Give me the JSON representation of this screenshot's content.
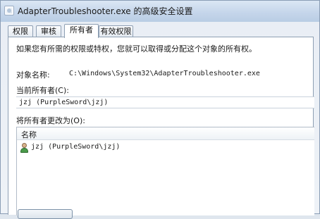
{
  "window": {
    "title": "AdapterTroubleshooter.exe 的高级安全设置"
  },
  "tabs": [
    {
      "label": "权限",
      "active": false
    },
    {
      "label": "审核",
      "active": false
    },
    {
      "label": "所有者",
      "active": true
    },
    {
      "label": "有效权限",
      "active": false
    }
  ],
  "owner_tab": {
    "intro": "如果您有所需的权限或特权，您就可以取得或分配这个对象的所有权。",
    "object_name_label": "对象名称:",
    "object_name_value": "C:\\Windows\\System32\\AdapterTroubleshooter.exe",
    "current_owner_label": "当前所有者(C):",
    "current_owner_value": "jzj (PurpleSword\\jzj)",
    "change_owner_label": "将所有者更改为(O):",
    "list_header": "名称",
    "list_items": [
      {
        "label": "jzj (PurpleSword\\jzj)",
        "icon": "user-icon"
      }
    ]
  }
}
